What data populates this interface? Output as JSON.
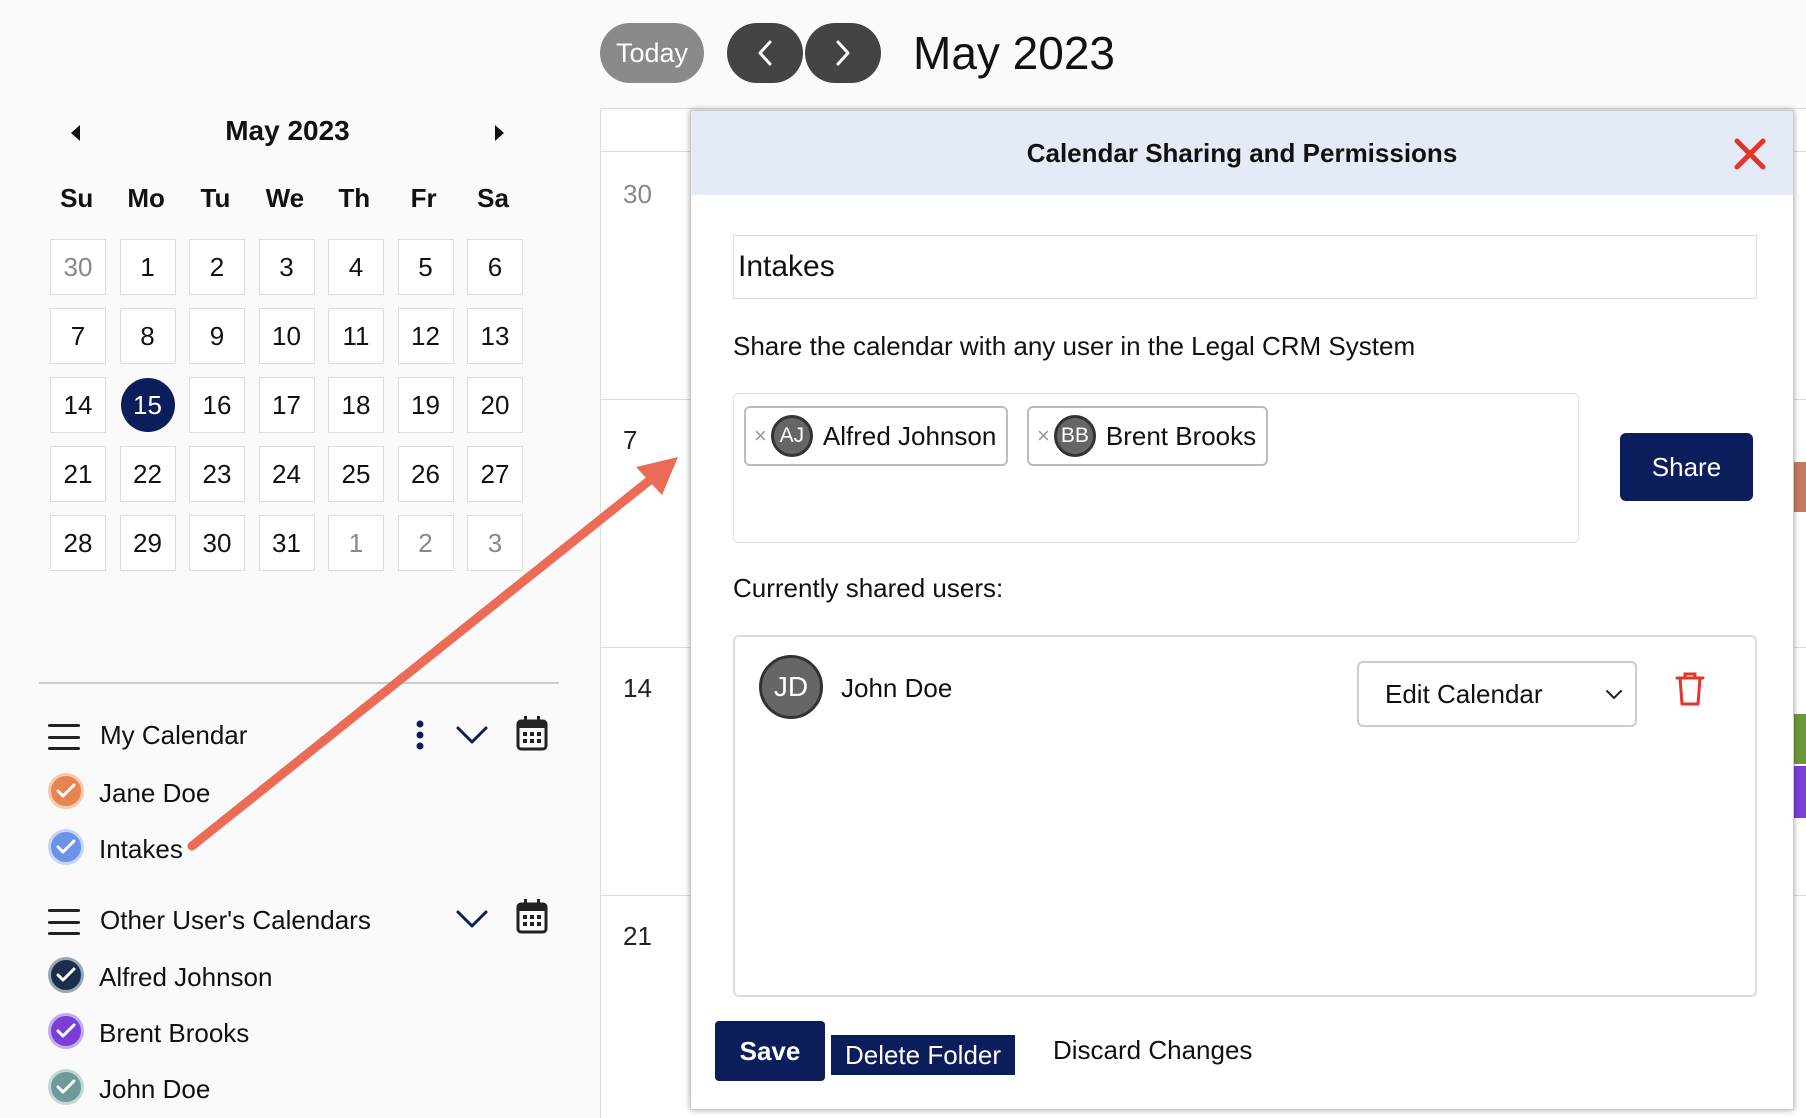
{
  "toolbar": {
    "today_label": "Today",
    "title": "May 2023"
  },
  "mini_calendar": {
    "title": "May 2023",
    "weekdays": [
      "Su",
      "Mo",
      "Tu",
      "We",
      "Th",
      "Fr",
      "Sa"
    ],
    "days": [
      [
        "30",
        "1",
        "2",
        "3",
        "4",
        "5",
        "6"
      ],
      [
        "7",
        "8",
        "9",
        "10",
        "11",
        "12",
        "13"
      ],
      [
        "14",
        "15",
        "16",
        "17",
        "18",
        "19",
        "20"
      ],
      [
        "21",
        "22",
        "23",
        "24",
        "25",
        "26",
        "27"
      ],
      [
        "28",
        "29",
        "30",
        "31",
        "1",
        "2",
        "3"
      ]
    ],
    "selected_day": "15"
  },
  "sidebar": {
    "my_calendar": {
      "label": "My Calendar",
      "items": [
        {
          "label": "Jane Doe",
          "color": "#e8844f"
        },
        {
          "label": "Intakes",
          "color": "#6b93e8"
        }
      ]
    },
    "other_calendars": {
      "label": "Other User's Calendars",
      "items": [
        {
          "label": "Alfred Johnson",
          "color": "#1c2e4a"
        },
        {
          "label": "Brent Brooks",
          "color": "#7a3fd8"
        },
        {
          "label": "John Doe",
          "color": "#6f9a9a"
        }
      ]
    }
  },
  "month_grid": {
    "week_starts": [
      "30",
      "7",
      "14",
      "21"
    ]
  },
  "modal": {
    "title": "Calendar Sharing and Permissions",
    "calendar_name": "Intakes",
    "share_prompt": "Share the calendar with any user in the Legal CRM System",
    "selected_users": [
      {
        "initials": "AJ",
        "name": "Alfred Johnson"
      },
      {
        "initials": "BB",
        "name": "Brent Brooks"
      }
    ],
    "share_label": "Share",
    "current_label": "Currently shared users:",
    "shared_users": [
      {
        "initials": "JD",
        "name": "John Doe",
        "permission": "Edit Calendar"
      }
    ],
    "save_label": "Save",
    "delete_label": "Delete Folder",
    "discard_label": "Discard Changes"
  },
  "colors": {
    "accent": "#0c1d5c",
    "annotation_arrow": "#ec6b56",
    "close_icon": "#e5332a",
    "trash_icon": "#e5332a"
  }
}
